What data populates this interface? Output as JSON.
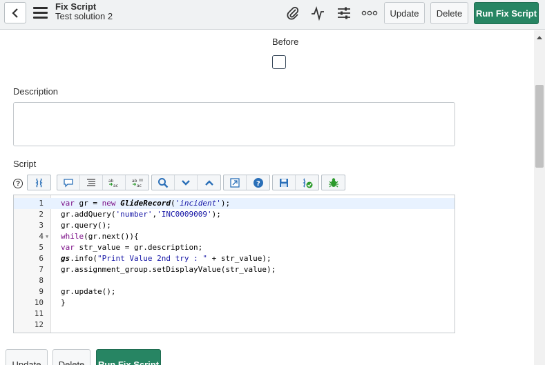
{
  "header": {
    "title": "Fix Script",
    "subtitle": "Test solution 2",
    "buttons": {
      "update": "Update",
      "delete": "Delete",
      "run": "Run Fix Script"
    },
    "icons": [
      "back-icon",
      "menu-icon",
      "paperclip-icon",
      "activity-icon",
      "settings-sliders-icon",
      "more-icon"
    ]
  },
  "form": {
    "before_label": "Before",
    "before_checked": false,
    "description_label": "Description",
    "description_value": "",
    "script_label": "Script"
  },
  "toolbar": {
    "help": "?",
    "icons": [
      "script-include-icon",
      "comment-icon",
      "format-icon",
      "replace-icon",
      "replace-all-icon",
      "search-icon",
      "next-icon",
      "previous-icon",
      "fullscreen-icon",
      "help-circle-icon",
      "save-icon",
      "validate-icon",
      "debug-icon"
    ]
  },
  "editor": {
    "line_numbers": [
      "1",
      "2",
      "3",
      "4",
      "5",
      "6",
      "7",
      "8",
      "9",
      "10",
      "11",
      "12"
    ],
    "active_line": 1
  },
  "footer": {
    "update": "Update",
    "delete": "Delete",
    "run": "Run Fix Script"
  },
  "colors": {
    "primary": "#278563",
    "header_bg": "#f0f2f3",
    "keyword": "#7a0d86",
    "string": "#1414a5"
  }
}
